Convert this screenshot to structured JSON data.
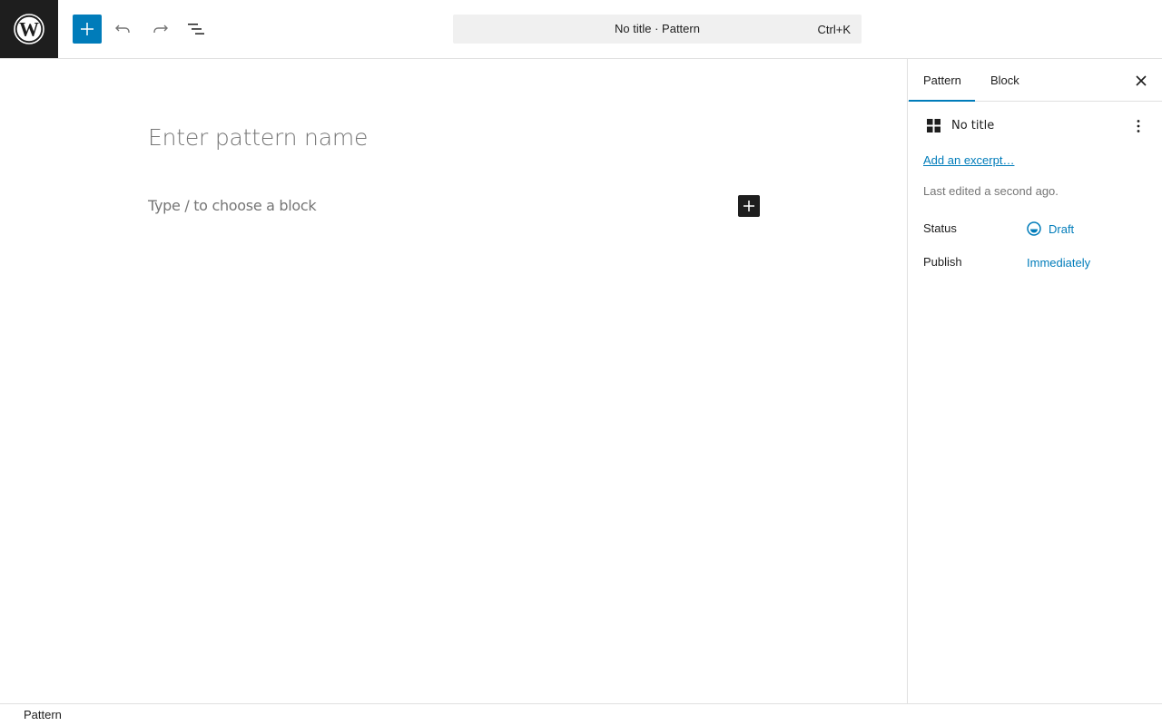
{
  "header": {
    "logo_icon": "wordpress-logo-icon",
    "add_block_icon": "plus-icon",
    "undo_icon": "undo-icon",
    "redo_icon": "redo-icon",
    "list_view_icon": "list-view-icon",
    "command_bar": {
      "title": "No title · Pattern",
      "shortcut": "Ctrl+K"
    }
  },
  "canvas": {
    "title_placeholder": "Enter pattern name",
    "block_placeholder": "Type / to choose a block",
    "inserter_icon": "plus-icon"
  },
  "sidebar": {
    "tabs": [
      {
        "label": "Pattern",
        "active": true
      },
      {
        "label": "Block",
        "active": false
      }
    ],
    "close_icon": "close-icon",
    "document": {
      "icon": "grid-icon",
      "title": "No title",
      "more_icon": "more-vertical-icon"
    },
    "excerpt_link": "Add an excerpt…",
    "last_edited": "Last edited a second ago.",
    "status": {
      "label": "Status",
      "value": "Draft",
      "icon": "draft-status-icon"
    },
    "publish": {
      "label": "Publish",
      "value": "Immediately"
    }
  },
  "footer": {
    "breadcrumb": "Pattern"
  },
  "colors": {
    "accent": "#007cba",
    "dark": "#1e1e1e",
    "muted": "#757575",
    "border": "#e0e0e0",
    "command_bg": "#f0f0f0"
  }
}
